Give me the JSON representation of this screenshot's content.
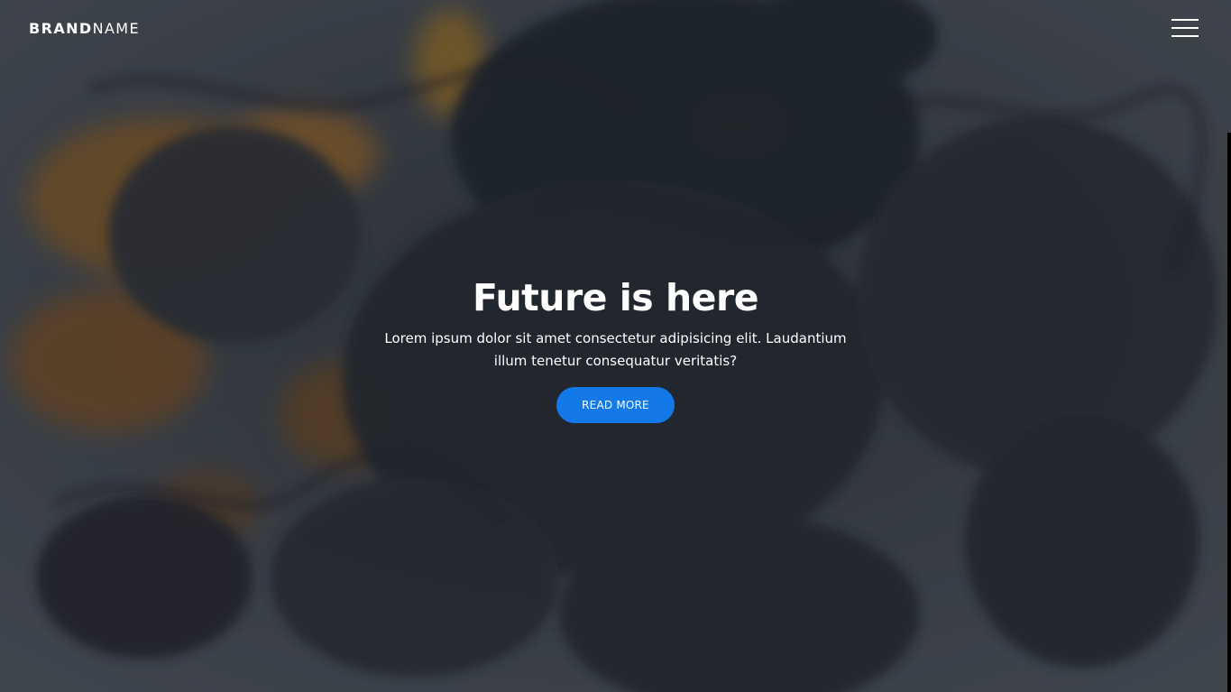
{
  "navbar": {
    "brand_bold": "BRAND",
    "brand_light": "NAME",
    "menu_icon": "hamburger-menu-icon"
  },
  "hero": {
    "title": "Future is here",
    "text": "Lorem ipsum dolor sit amet consectetur adipisicing elit. Laudantium illum tenetur consequatur veritatis?",
    "button_label": "READ MORE",
    "background": "ink-smoke-image"
  },
  "colors": {
    "accent": "#1378e8",
    "text": "#ffffff",
    "background": "#3a4048"
  }
}
